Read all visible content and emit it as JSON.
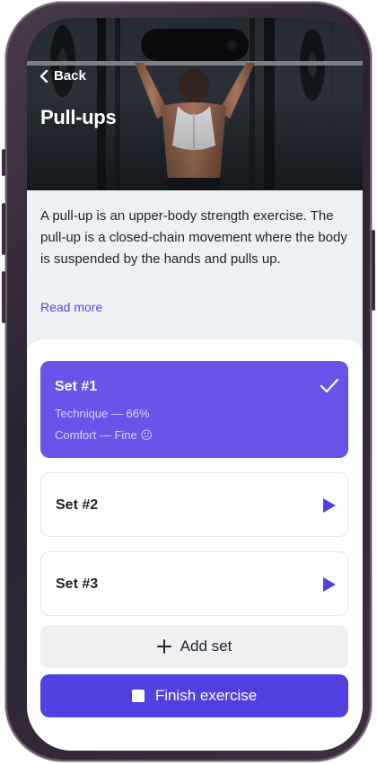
{
  "navigation": {
    "back_label": "Back"
  },
  "exercise": {
    "title": "Pull-ups",
    "description": "A pull-up is an upper-body strength exercise. The pull-up is a closed-chain movement where the body is suspended by the hands and pulls up.",
    "read_more_label": "Read more"
  },
  "sets": [
    {
      "title": "Set #1",
      "status": "completed",
      "technique": "Technique — 66%",
      "comfort": "Comfort — Fine",
      "comfort_emoji": "😐"
    },
    {
      "title": "Set #2",
      "status": "pending"
    },
    {
      "title": "Set #3",
      "status": "pending"
    }
  ],
  "actions": {
    "add_set_label": "Add set",
    "finish_label": "Finish exercise"
  },
  "colors": {
    "accent": "#6655e8",
    "accent_dark": "#5140e0",
    "link": "#5a48e6",
    "play": "#5140e0"
  },
  "icons": {
    "back": "chevron-left-icon",
    "completed": "checkmark-icon",
    "start": "play-icon",
    "add": "plus-icon",
    "finish": "checkbox-icon"
  }
}
